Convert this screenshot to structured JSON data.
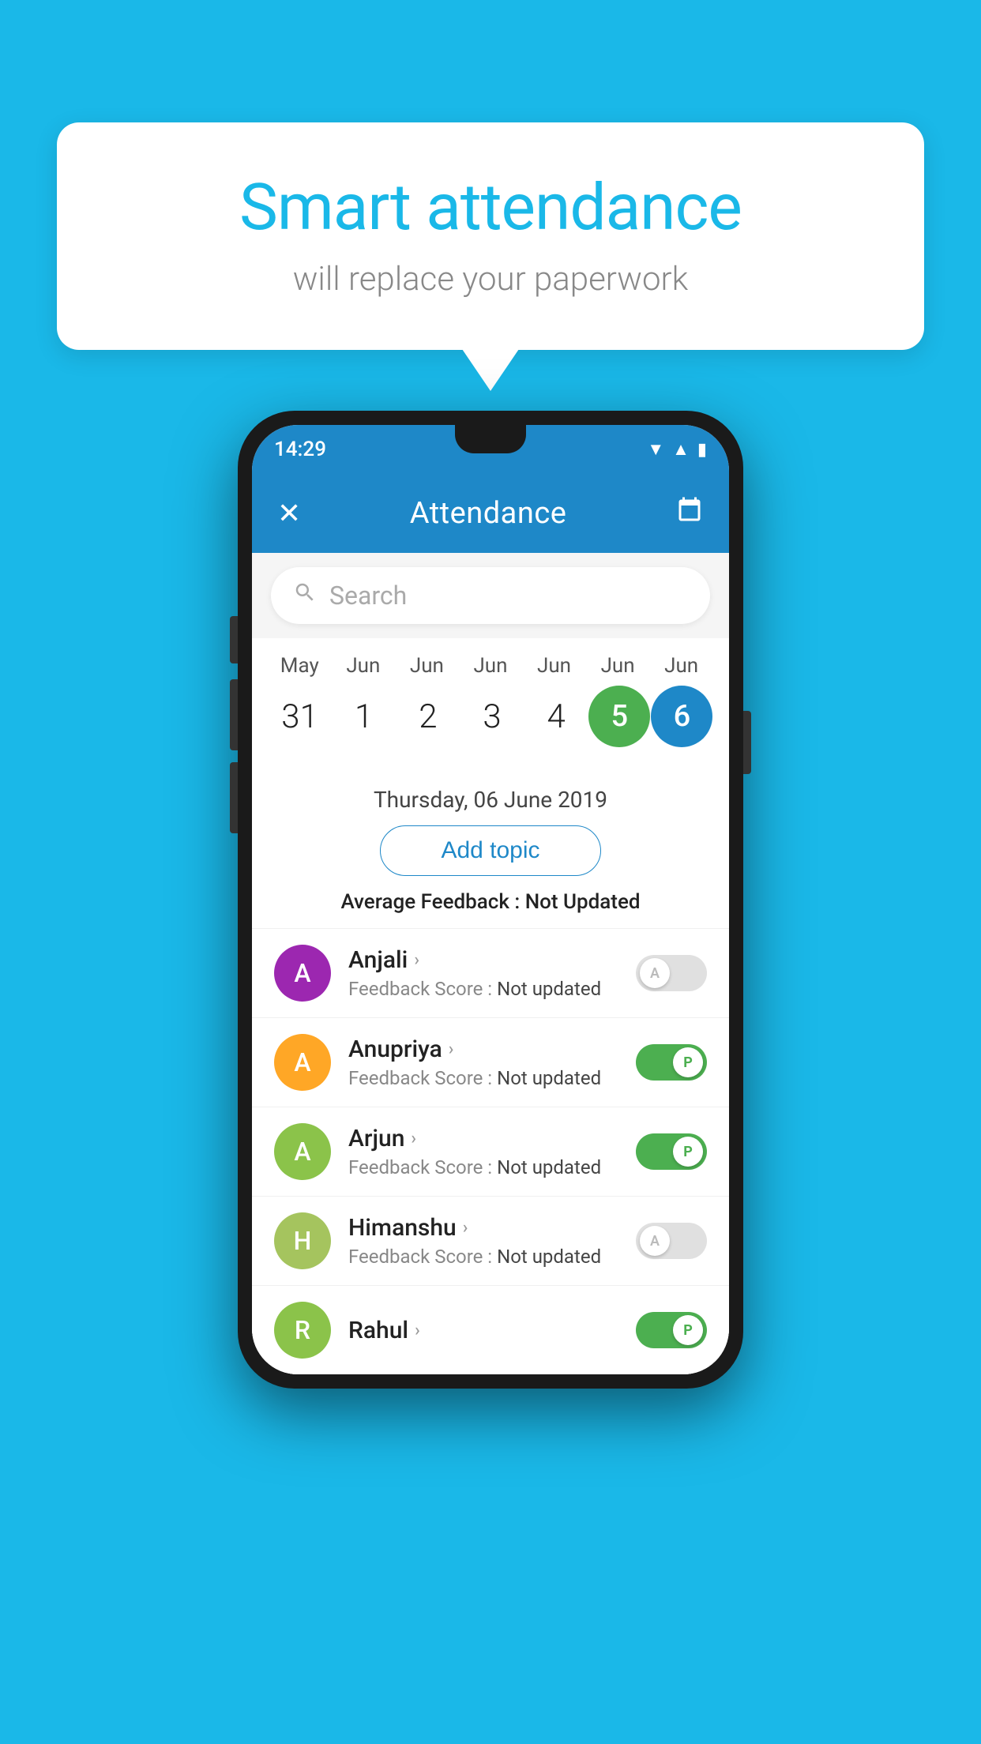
{
  "background": {
    "color": "#1ab8e8"
  },
  "bubble": {
    "title": "Smart attendance",
    "subtitle": "will replace your paperwork"
  },
  "phone": {
    "status_bar": {
      "time": "14:29",
      "wifi_icon": "▼",
      "signal_icon": "▲",
      "battery_icon": "▮"
    },
    "app_bar": {
      "close_icon": "✕",
      "title": "Attendance",
      "calendar_icon": "📅"
    },
    "search": {
      "placeholder": "Search"
    },
    "calendar": {
      "months": [
        "May",
        "Jun",
        "Jun",
        "Jun",
        "Jun",
        "Jun",
        "Jun"
      ],
      "dates": [
        "31",
        "1",
        "2",
        "3",
        "4",
        "5",
        "6"
      ],
      "today_index": 5,
      "selected_index": 6
    },
    "selected_date": "Thursday, 06 June 2019",
    "add_topic_label": "Add topic",
    "avg_feedback_label": "Average Feedback : ",
    "avg_feedback_value": "Not Updated",
    "students": [
      {
        "name": "Anjali",
        "avatar_letter": "A",
        "avatar_color": "#9c27b0",
        "score_label": "Feedback Score : ",
        "score_value": "Not updated",
        "toggle": "off",
        "toggle_letter": "A"
      },
      {
        "name": "Anupriya",
        "avatar_letter": "A",
        "avatar_color": "#ffa726",
        "score_label": "Feedback Score : ",
        "score_value": "Not updated",
        "toggle": "on",
        "toggle_letter": "P"
      },
      {
        "name": "Arjun",
        "avatar_letter": "A",
        "avatar_color": "#8bc34a",
        "score_label": "Feedback Score : ",
        "score_value": "Not updated",
        "toggle": "on",
        "toggle_letter": "P"
      },
      {
        "name": "Himanshu",
        "avatar_letter": "H",
        "avatar_color": "#a5c45e",
        "score_label": "Feedback Score : ",
        "score_value": "Not updated",
        "toggle": "off",
        "toggle_letter": "A"
      }
    ]
  }
}
